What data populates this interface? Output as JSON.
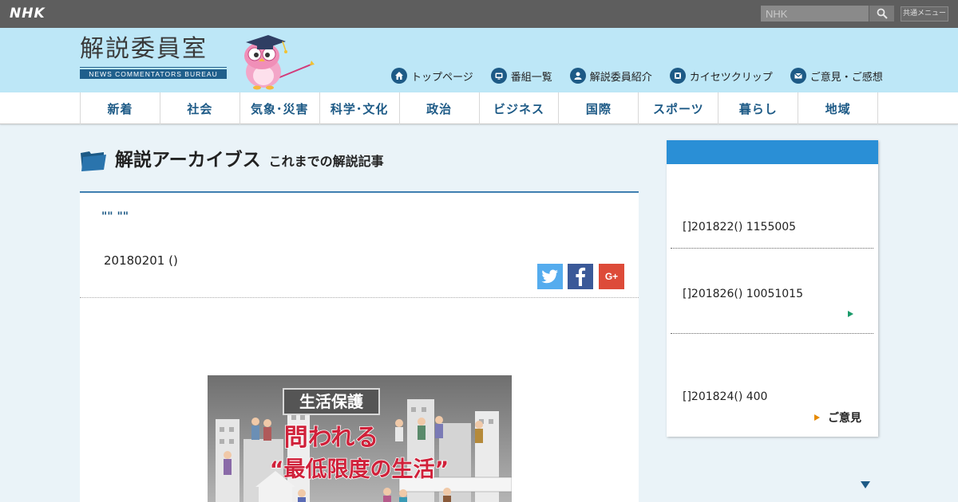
{
  "topbar": {
    "logo": "NHK",
    "search_placeholder": "NHK",
    "common_menu": "共通メニュー"
  },
  "header": {
    "title": "解説委員室",
    "subtitle": "NEWS COMMENTATORS BUREAU",
    "nav": [
      {
        "label": "トップページ",
        "icon": "home-icon"
      },
      {
        "label": "番組一覧",
        "icon": "tv-icon"
      },
      {
        "label": "解説委員紹介",
        "icon": "person-icon"
      },
      {
        "label": "カイセツクリップ",
        "icon": "film-icon"
      },
      {
        "label": "ご意見・ご感想",
        "icon": "mail-icon"
      }
    ]
  },
  "categories": [
    "新着",
    "社会",
    "気象･災害",
    "科学･文化",
    "政治",
    "ビジネス",
    "国際",
    "スポーツ",
    "暮らし",
    "地域"
  ],
  "archive": {
    "title": "解説アーカイブス",
    "subtitle": "これまでの解説記事"
  },
  "article": {
    "title": "\"\" \"\"",
    "date": "20180201 ()",
    "image_text": {
      "tag": "生活保護",
      "line1": "問われる",
      "line2": "“最低限度の生活”"
    }
  },
  "sidebar": {
    "items": [
      {
        "label": "[]201822() 1155005"
      },
      {
        "label": "[]201826() 10051015"
      },
      {
        "label": "[]201824() 400"
      }
    ],
    "opinion_label": "ご意見"
  },
  "colors": {
    "topbar": "#5e5e5e",
    "header_bg": "#bde7f7",
    "page_bg": "#eaf3f8",
    "accent": "#1d5a86",
    "sidebar_head": "#2a8fd6"
  }
}
